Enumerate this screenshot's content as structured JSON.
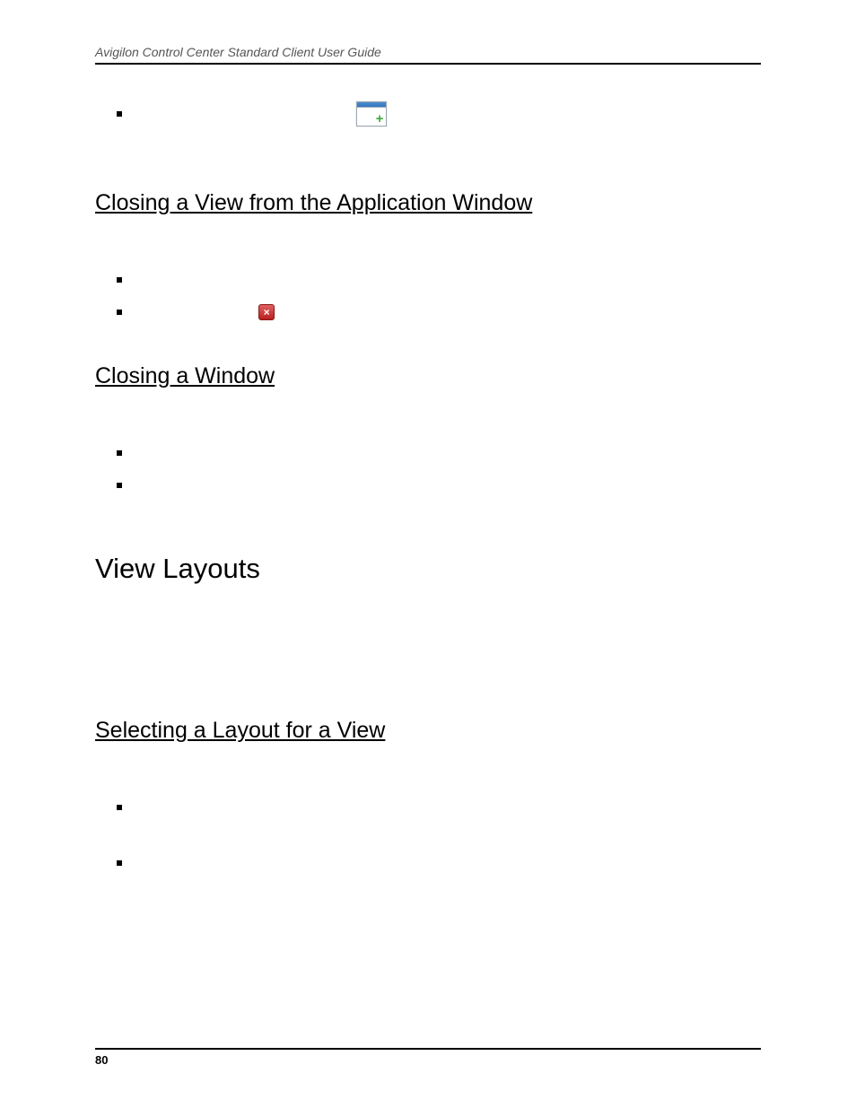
{
  "header": {
    "running_title": "Avigilon Control Center Standard Client User Guide"
  },
  "sections": {
    "closing_view": {
      "heading": "Closing a View from the Application Window"
    },
    "closing_window": {
      "heading": "Closing a Window"
    },
    "view_layouts": {
      "heading": "View Layouts"
    },
    "selecting_layout": {
      "heading": "Selecting a Layout for a View"
    }
  },
  "icons": {
    "new_window": "new-window-icon",
    "close": "close-icon"
  },
  "footer": {
    "page_number": "80"
  }
}
